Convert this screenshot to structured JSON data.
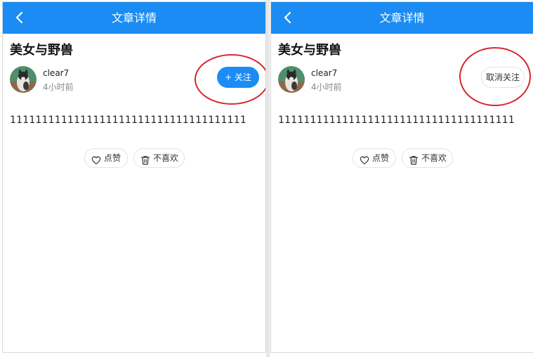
{
  "panels": [
    {
      "navbar": {
        "title": "文章详情"
      },
      "article": {
        "title": "美女与野兽",
        "author": "clear7",
        "time": "4小时前",
        "content": "1111111111111111111111111111111111111"
      },
      "follow_button": {
        "label": "+ 关注",
        "state": "not-following"
      },
      "actions": {
        "like_label": "点赞",
        "dislike_label": "不喜欢"
      }
    },
    {
      "navbar": {
        "title": "文章详情"
      },
      "article": {
        "title": "美女与野兽",
        "author": "clear7",
        "time": "4小时前",
        "content": "1111111111111111111111111111111111111"
      },
      "follow_button": {
        "label": "取消关注",
        "state": "following"
      },
      "actions": {
        "like_label": "点赞",
        "dislike_label": "不喜欢"
      }
    }
  ],
  "colors": {
    "navbar_bg": "#1b8cf3",
    "follow_button_bg": "#1b8cf3",
    "annotation_ellipse": "#d8262f"
  },
  "icons": {
    "back": "chevron-left-icon",
    "like": "heart-outline-icon",
    "dislike": "trash-icon"
  }
}
